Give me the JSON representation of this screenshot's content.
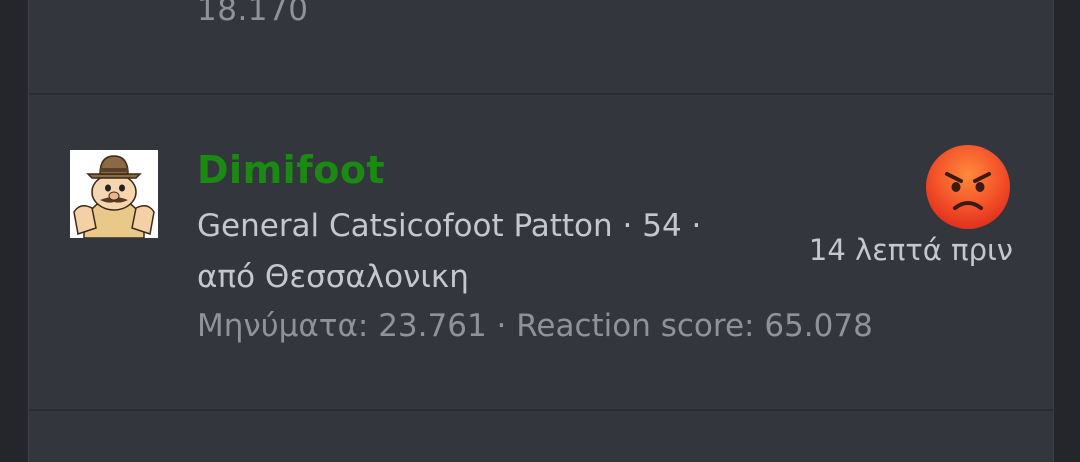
{
  "previous_item": {
    "score_text": "18.170"
  },
  "member": {
    "username": "Dimifoot",
    "title_line": "General Catsicofoot Patton · 54 ·",
    "location_line": "από Θεσσαλονικη",
    "stats_line": "Μηνύματα: 23.761 · Reaction score: 65.078",
    "reaction_icon": "angry-face-icon",
    "time": "14 λεπτά πριν",
    "username_color": "#1a8a12"
  }
}
